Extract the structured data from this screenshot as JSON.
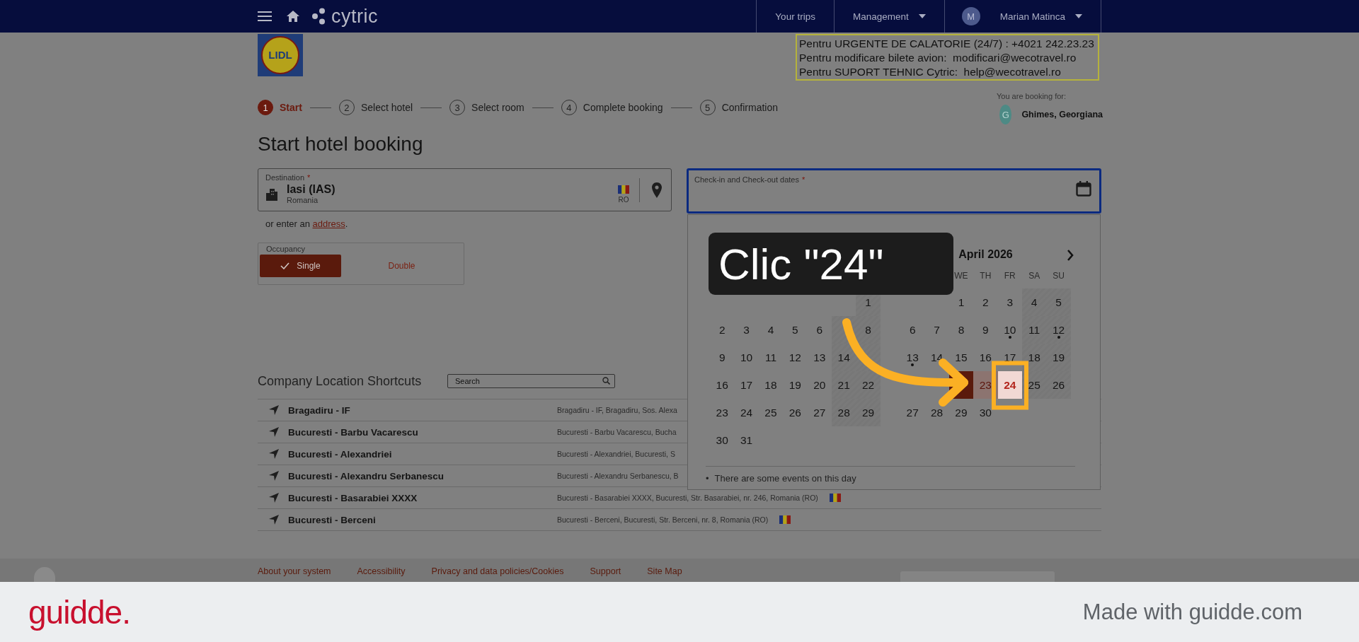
{
  "header": {
    "logo_text": "cytric",
    "nav": [
      {
        "label": "Your trips",
        "dropdown": false
      },
      {
        "label": "Management",
        "dropdown": true
      }
    ],
    "user": {
      "initial": "M",
      "name": "Marian Matinca",
      "dropdown": true
    }
  },
  "company_logo": {
    "text": "LIDL"
  },
  "contact_notice": [
    "Pentru URGENTE DE CALATORIE (24/7) : +4021 242.23.23",
    "Pentru modificare bilete avion:  modificari@wecotravel.ro",
    "Pentru SUPORT TEHNIC Cytric:  help@wecotravel.ro"
  ],
  "steps": [
    {
      "number": "1",
      "label": "Start",
      "selected": true
    },
    {
      "number": "2",
      "label": "Select hotel",
      "selected": false
    },
    {
      "number": "3",
      "label": "Select room",
      "selected": false
    },
    {
      "number": "4",
      "label": "Complete booking",
      "selected": false
    },
    {
      "number": "5",
      "label": "Confirmation",
      "selected": false
    }
  ],
  "booking_for": {
    "label": "You are booking for:",
    "initial": "G",
    "name": "Ghimes, Georgiana"
  },
  "title": "Start hotel booking",
  "destination": {
    "label": "Destination",
    "required_mark": "*",
    "value": "Iasi (IAS)",
    "country": "Romania",
    "country_code": "RO"
  },
  "address_hint": {
    "text": "or enter an ",
    "link": "address",
    "suffix": "."
  },
  "occupancy": {
    "label": "Occupancy",
    "options": [
      {
        "label": "Single",
        "selected": true
      },
      {
        "label": "Double",
        "selected": false
      }
    ]
  },
  "dates": {
    "label": "Check-in and Check-out dates",
    "required_mark": "*",
    "focused": true
  },
  "calendar": {
    "months": [
      {
        "weeks": [
          {
            "kind": "first",
            "days": [
              {
                "day": "1"
              }
            ]
          },
          {
            "kind": "full",
            "days": [
              {
                "day": "2"
              },
              {
                "day": "3"
              },
              {
                "day": "4"
              },
              {
                "day": "5"
              },
              {
                "day": "6"
              },
              {
                "kind": "covered"
              },
              {
                "day": "8"
              }
            ]
          },
          {
            "kind": "full",
            "days": [
              {
                "day": "9"
              },
              {
                "day": "10"
              },
              {
                "day": "11"
              },
              {
                "day": "12"
              },
              {
                "day": "13"
              },
              {
                "day": "14"
              },
              {
                "kind": "covered"
              }
            ]
          },
          {
            "kind": "full",
            "days": [
              {
                "day": "16"
              },
              {
                "day": "17"
              },
              {
                "day": "18"
              },
              {
                "day": "19"
              },
              {
                "day": "20"
              },
              {
                "day": "21"
              },
              {
                "day": "22"
              }
            ]
          },
          {
            "kind": "full",
            "days": [
              {
                "day": "23"
              },
              {
                "day": "24"
              },
              {
                "day": "25"
              },
              {
                "day": "26"
              },
              {
                "day": "27"
              },
              {
                "day": "28"
              },
              {
                "day": "29"
              }
            ]
          },
          {
            "kind": "last",
            "days": [
              {
                "day": "30"
              },
              {
                "day": "31"
              }
            ]
          }
        ]
      },
      {
        "title": "April 2026",
        "has_next": true,
        "weekdays": [
          "WE",
          "TH",
          "FR",
          "SA",
          "SU"
        ],
        "weeks": [
          {
            "kind": "first",
            "days": [
              {
                "day": "1"
              },
              {
                "day": "2"
              },
              {
                "day": "3"
              },
              {
                "day": "4"
              },
              {
                "day": "5"
              }
            ]
          },
          {
            "kind": "full",
            "days": [
              {
                "day": "6"
              },
              {
                "day": "7"
              },
              {
                "day": "8"
              },
              {
                "day": "9"
              },
              {
                "day": "10",
                "event": true
              },
              {
                "day": "11"
              },
              {
                "day": "12",
                "event": true
              }
            ]
          },
          {
            "kind": "full",
            "days": [
              {
                "day": "13",
                "event": true
              },
              {
                "day": "14"
              },
              {
                "day": "15"
              },
              {
                "day": "16"
              },
              {
                "day": "17"
              },
              {
                "day": "18"
              },
              {
                "day": "19"
              }
            ]
          },
          {
            "kind": "full",
            "days": [
              {
                "kind": "covered"
              },
              {
                "kind": "covered"
              },
              {
                "kind": "covered",
                "range_start": true
              },
              {
                "day": "23",
                "in_range": true
              },
              {
                "day": "24",
                "hovered": true
              },
              {
                "day": "25"
              },
              {
                "day": "26"
              }
            ]
          },
          {
            "kind": "last",
            "days": [
              {
                "day": "27"
              },
              {
                "day": "28"
              },
              {
                "day": "29"
              },
              {
                "day": "30"
              }
            ]
          }
        ]
      }
    ],
    "legend_mark": "•",
    "legend": "There are some events on this day"
  },
  "guide": {
    "callout": "Clic \"24\""
  },
  "shortcuts": {
    "title": "Company Location Shortcuts",
    "search_placeholder": "Search",
    "rows": [
      {
        "name": "Bragadiru - IF",
        "address": "Bragadiru - IF, Bragadiru, Sos. Alexa"
      },
      {
        "name": "Bucuresti - Barbu Vacarescu",
        "address": "Bucuresti - Barbu Vacarescu, Bucha"
      },
      {
        "name": "Bucuresti - Alexandriei",
        "address": "Bucuresti - Alexandriei, Bucuresti, S"
      },
      {
        "name": "Bucuresti - Alexandru Serbanescu",
        "address": "Bucuresti - Alexandru Serbanescu, B"
      },
      {
        "name": "Bucuresti - Basarabiei XXXX",
        "address": "Bucuresti - Basarabiei XXXX, Bucuresti, Str. Basarabiei, nr. 246, Romania (RO)",
        "flag": true
      },
      {
        "name": "Bucuresti - Berceni",
        "address": "Bucuresti - Berceni, Bucuresti, Str. Berceni, nr. 8, Romania (RO)",
        "flag": true
      }
    ]
  },
  "footer": {
    "links": [
      "About your system",
      "Accessibility",
      "Privacy and data policies/Cookies",
      "Support",
      "Site Map"
    ]
  },
  "guidde_bar": {
    "logo": "guidde.",
    "tagline": "Made with guidde.com"
  }
}
